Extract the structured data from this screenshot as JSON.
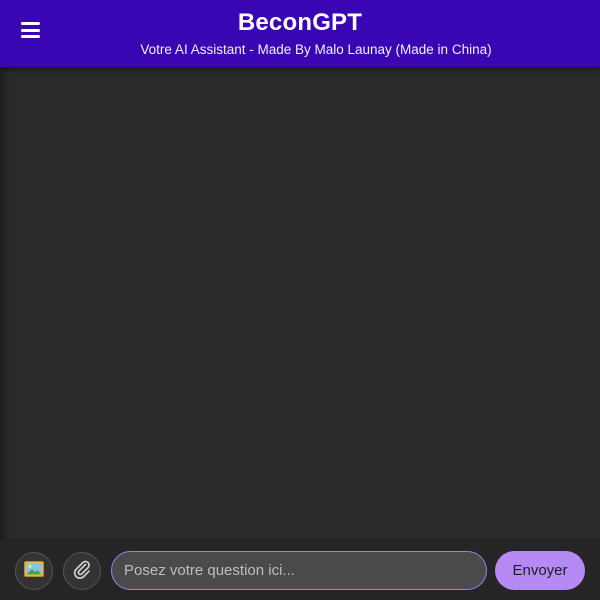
{
  "header": {
    "title": "BeconGPT",
    "subtitle": "Votre AI Assistant - Made By Malo Launay (Made in China)",
    "menu_icon": "hamburger-menu-icon",
    "background_color": "#3a06b4"
  },
  "chat": {
    "background_color": "#2a2a2a"
  },
  "input_bar": {
    "image_icon": "image-picture-icon",
    "attach_icon": "paperclip-icon",
    "question": {
      "value": "",
      "placeholder": "Posez votre question ici..."
    },
    "send_label": "Envoyer",
    "accent_color": "#b58af5"
  }
}
